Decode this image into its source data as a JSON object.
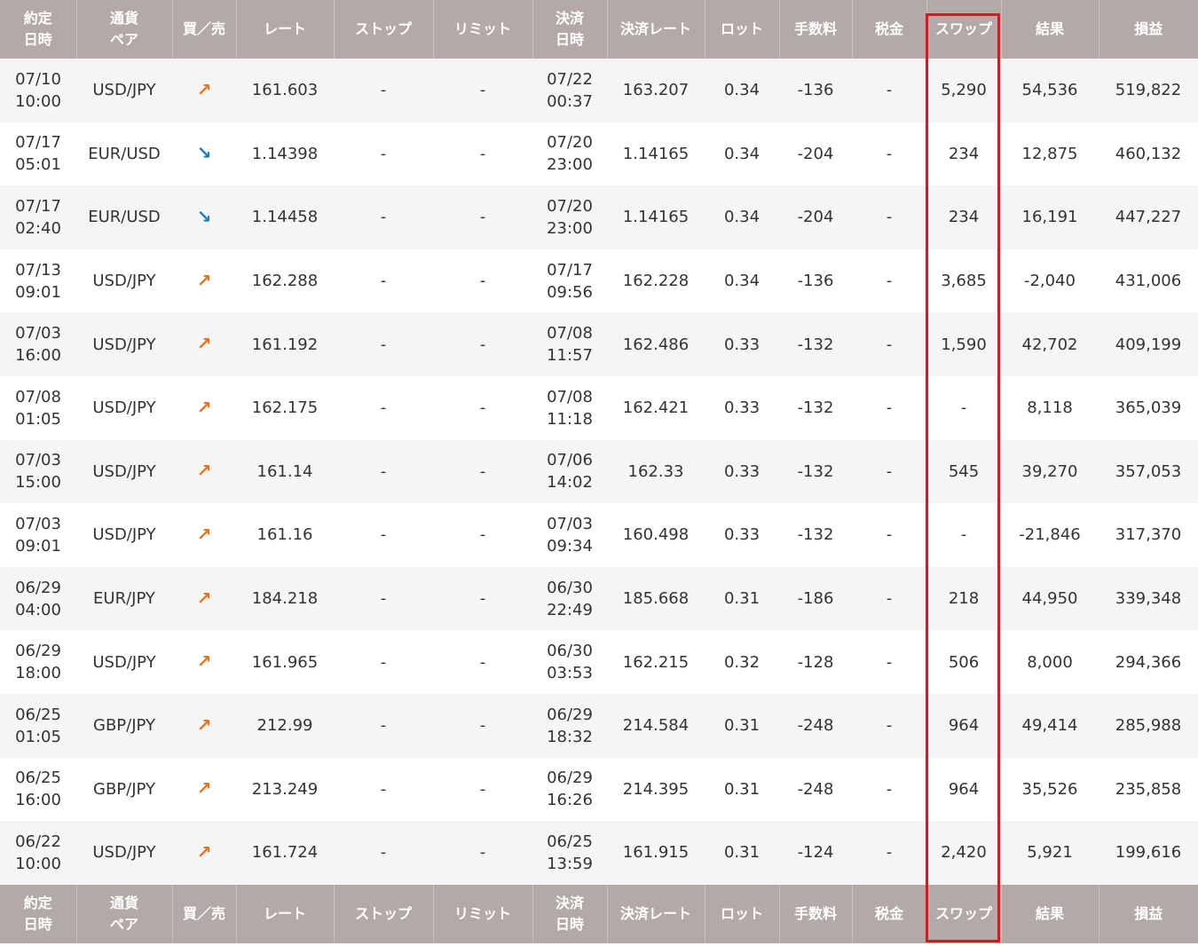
{
  "columns": [
    {
      "key": "entry_time",
      "label": "約定\n日時"
    },
    {
      "key": "pair",
      "label": "通貨\nペア"
    },
    {
      "key": "side",
      "label": "買／売"
    },
    {
      "key": "rate",
      "label": "レート"
    },
    {
      "key": "stop",
      "label": "ストップ"
    },
    {
      "key": "limit",
      "label": "リミット"
    },
    {
      "key": "exit_time",
      "label": "決済\n日時"
    },
    {
      "key": "exit_rate",
      "label": "決済レート"
    },
    {
      "key": "lot",
      "label": "ロット"
    },
    {
      "key": "fee",
      "label": "手数料"
    },
    {
      "key": "tax",
      "label": "税金"
    },
    {
      "key": "swap",
      "label": "スワップ"
    },
    {
      "key": "result",
      "label": "結果"
    },
    {
      "key": "pnl",
      "label": "損益"
    }
  ],
  "rows": [
    {
      "entry_time": "07/10\n10:00",
      "pair": "USD/JPY",
      "side": "↗",
      "side_dir": "up",
      "rate": "161.603",
      "stop": "-",
      "limit": "-",
      "exit_time": "07/22\n00:37",
      "exit_rate": "163.207",
      "lot": "0.34",
      "fee": "-136",
      "tax": "-",
      "swap": "5,290",
      "result": "54,536",
      "pnl": "519,822"
    },
    {
      "entry_time": "07/17\n05:01",
      "pair": "EUR/USD",
      "side": "↘",
      "side_dir": "down",
      "rate": "1.14398",
      "stop": "-",
      "limit": "-",
      "exit_time": "07/20\n23:00",
      "exit_rate": "1.14165",
      "lot": "0.34",
      "fee": "-204",
      "tax": "-",
      "swap": "234",
      "result": "12,875",
      "pnl": "460,132"
    },
    {
      "entry_time": "07/17\n02:40",
      "pair": "EUR/USD",
      "side": "↘",
      "side_dir": "down",
      "rate": "1.14458",
      "stop": "-",
      "limit": "-",
      "exit_time": "07/20\n23:00",
      "exit_rate": "1.14165",
      "lot": "0.34",
      "fee": "-204",
      "tax": "-",
      "swap": "234",
      "result": "16,191",
      "pnl": "447,227"
    },
    {
      "entry_time": "07/13\n09:01",
      "pair": "USD/JPY",
      "side": "↗",
      "side_dir": "up",
      "rate": "162.288",
      "stop": "-",
      "limit": "-",
      "exit_time": "07/17\n09:56",
      "exit_rate": "162.228",
      "lot": "0.34",
      "fee": "-136",
      "tax": "-",
      "swap": "3,685",
      "result": "-2,040",
      "pnl": "431,006"
    },
    {
      "entry_time": "07/03\n16:00",
      "pair": "USD/JPY",
      "side": "↗",
      "side_dir": "up",
      "rate": "161.192",
      "stop": "-",
      "limit": "-",
      "exit_time": "07/08\n11:57",
      "exit_rate": "162.486",
      "lot": "0.33",
      "fee": "-132",
      "tax": "-",
      "swap": "1,590",
      "result": "42,702",
      "pnl": "409,199"
    },
    {
      "entry_time": "07/08\n01:05",
      "pair": "USD/JPY",
      "side": "↗",
      "side_dir": "up",
      "rate": "162.175",
      "stop": "-",
      "limit": "-",
      "exit_time": "07/08\n11:18",
      "exit_rate": "162.421",
      "lot": "0.33",
      "fee": "-132",
      "tax": "-",
      "swap": "-",
      "result": "8,118",
      "pnl": "365,039"
    },
    {
      "entry_time": "07/03\n15:00",
      "pair": "USD/JPY",
      "side": "↗",
      "side_dir": "up",
      "rate": "161.14",
      "stop": "-",
      "limit": "-",
      "exit_time": "07/06\n14:02",
      "exit_rate": "162.33",
      "lot": "0.33",
      "fee": "-132",
      "tax": "-",
      "swap": "545",
      "result": "39,270",
      "pnl": "357,053"
    },
    {
      "entry_time": "07/03\n09:01",
      "pair": "USD/JPY",
      "side": "↗",
      "side_dir": "up",
      "rate": "161.16",
      "stop": "-",
      "limit": "-",
      "exit_time": "07/03\n09:34",
      "exit_rate": "160.498",
      "lot": "0.33",
      "fee": "-132",
      "tax": "-",
      "swap": "-",
      "result": "-21,846",
      "pnl": "317,370"
    },
    {
      "entry_time": "06/29\n04:00",
      "pair": "EUR/JPY",
      "side": "↗",
      "side_dir": "up",
      "rate": "184.218",
      "stop": "-",
      "limit": "-",
      "exit_time": "06/30\n22:49",
      "exit_rate": "185.668",
      "lot": "0.31",
      "fee": "-186",
      "tax": "-",
      "swap": "218",
      "result": "44,950",
      "pnl": "339,348"
    },
    {
      "entry_time": "06/29\n18:00",
      "pair": "USD/JPY",
      "side": "↗",
      "side_dir": "up",
      "rate": "161.965",
      "stop": "-",
      "limit": "-",
      "exit_time": "06/30\n03:53",
      "exit_rate": "162.215",
      "lot": "0.32",
      "fee": "-128",
      "tax": "-",
      "swap": "506",
      "result": "8,000",
      "pnl": "294,366"
    },
    {
      "entry_time": "06/25\n01:05",
      "pair": "GBP/JPY",
      "side": "↗",
      "side_dir": "up",
      "rate": "212.99",
      "stop": "-",
      "limit": "-",
      "exit_time": "06/29\n18:32",
      "exit_rate": "214.584",
      "lot": "0.31",
      "fee": "-248",
      "tax": "-",
      "swap": "964",
      "result": "49,414",
      "pnl": "285,988"
    },
    {
      "entry_time": "06/25\n16:00",
      "pair": "GBP/JPY",
      "side": "↗",
      "side_dir": "up",
      "rate": "213.249",
      "stop": "-",
      "limit": "-",
      "exit_time": "06/29\n16:26",
      "exit_rate": "214.395",
      "lot": "0.31",
      "fee": "-248",
      "tax": "-",
      "swap": "964",
      "result": "35,526",
      "pnl": "235,858"
    },
    {
      "entry_time": "06/22\n10:00",
      "pair": "USD/JPY",
      "side": "↗",
      "side_dir": "up",
      "rate": "161.724",
      "stop": "-",
      "limit": "-",
      "exit_time": "06/25\n13:59",
      "exit_rate": "161.915",
      "lot": "0.31",
      "fee": "-124",
      "tax": "-",
      "swap": "2,420",
      "result": "5,921",
      "pnl": "199,616"
    }
  ],
  "colors": {
    "header_bg": "#b3aaa8",
    "row_alt_bg": "#f5f5f5",
    "buy_arrow": "#e8721c",
    "sell_arrow": "#1f7bc4",
    "highlight_border": "#e0141e"
  },
  "highlight": {
    "column": "swap"
  }
}
